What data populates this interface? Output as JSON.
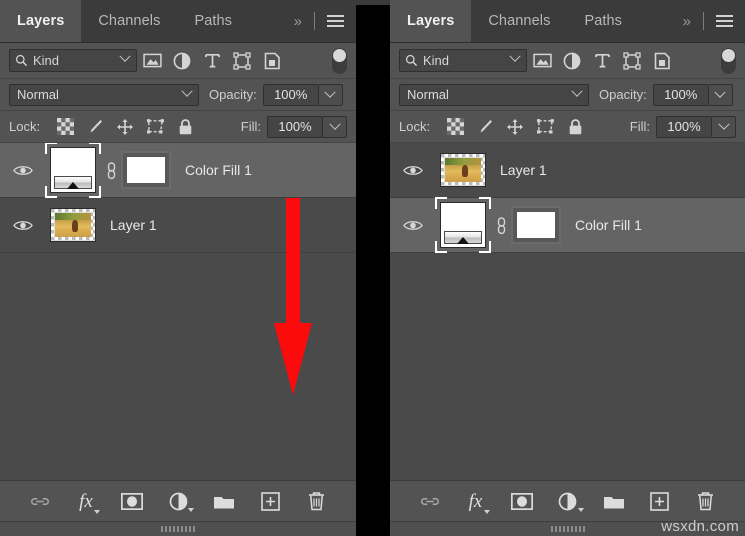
{
  "panels": [
    {
      "id": "before",
      "tabs": [
        {
          "label": "Layers",
          "active": true
        },
        {
          "label": "Channels",
          "active": false
        },
        {
          "label": "Paths",
          "active": false
        }
      ],
      "overflow_label": "»",
      "filter": {
        "icon": "search-icon",
        "value": "Kind",
        "type_icons": [
          "pixel-layer-filter-icon",
          "adjustment-layer-filter-icon",
          "type-layer-filter-icon",
          "shape-layer-filter-icon",
          "smart-object-filter-icon"
        ],
        "toggle": "filter-enable-toggle"
      },
      "blend": {
        "mode": "Normal",
        "opacity_label": "Opacity:",
        "opacity_value": "100%"
      },
      "lock": {
        "label": "Lock:",
        "icons": [
          "lock-transparent-pixels-icon",
          "lock-image-pixels-icon",
          "lock-position-icon",
          "lock-artboard-nesting-icon",
          "lock-all-icon"
        ],
        "fill_label": "Fill:",
        "fill_value": "100%"
      },
      "layers": [
        {
          "name": "Color Fill 1",
          "type": "fill",
          "selected": true,
          "visible": true,
          "linked": true,
          "has_mask": true
        },
        {
          "name": "Layer 1",
          "type": "pixel",
          "selected": false,
          "visible": true,
          "linked": false,
          "has_mask": false
        }
      ],
      "bottom_icons": [
        "link-layers-icon",
        "layer-style-fx-icon",
        "add-layer-mask-icon",
        "new-adjustment-layer-icon",
        "new-group-icon",
        "new-layer-icon",
        "delete-layer-icon"
      ]
    },
    {
      "id": "after",
      "tabs": [
        {
          "label": "Layers",
          "active": true
        },
        {
          "label": "Channels",
          "active": false
        },
        {
          "label": "Paths",
          "active": false
        }
      ],
      "overflow_label": "»",
      "filter": {
        "icon": "search-icon",
        "value": "Kind",
        "type_icons": [
          "pixel-layer-filter-icon",
          "adjustment-layer-filter-icon",
          "type-layer-filter-icon",
          "shape-layer-filter-icon",
          "smart-object-filter-icon"
        ],
        "toggle": "filter-enable-toggle"
      },
      "blend": {
        "mode": "Normal",
        "opacity_label": "Opacity:",
        "opacity_value": "100%"
      },
      "lock": {
        "label": "Lock:",
        "icons": [
          "lock-transparent-pixels-icon",
          "lock-image-pixels-icon",
          "lock-position-icon",
          "lock-artboard-nesting-icon",
          "lock-all-icon"
        ],
        "fill_label": "Fill:",
        "fill_value": "100%"
      },
      "layers": [
        {
          "name": "Layer 1",
          "type": "pixel",
          "selected": false,
          "visible": true,
          "linked": false,
          "has_mask": false
        },
        {
          "name": "Color Fill 1",
          "type": "fill",
          "selected": true,
          "visible": true,
          "linked": true,
          "has_mask": true
        }
      ],
      "bottom_icons": [
        "link-layers-icon",
        "layer-style-fx-icon",
        "add-layer-mask-icon",
        "new-adjustment-layer-icon",
        "new-group-icon",
        "new-layer-icon",
        "delete-layer-icon"
      ]
    }
  ],
  "annotation": {
    "arrow": "red-down-arrow",
    "color": "#fb0b0b"
  },
  "watermark": {
    "text": "wsxdn.com"
  },
  "colors": {
    "panel_bg": "#535353",
    "list_bg": "#4a4a4a",
    "tabbar_bg": "#3b3b3b",
    "selected_row": "#646464",
    "text": "#e8e8e8",
    "gap": "#000000"
  }
}
